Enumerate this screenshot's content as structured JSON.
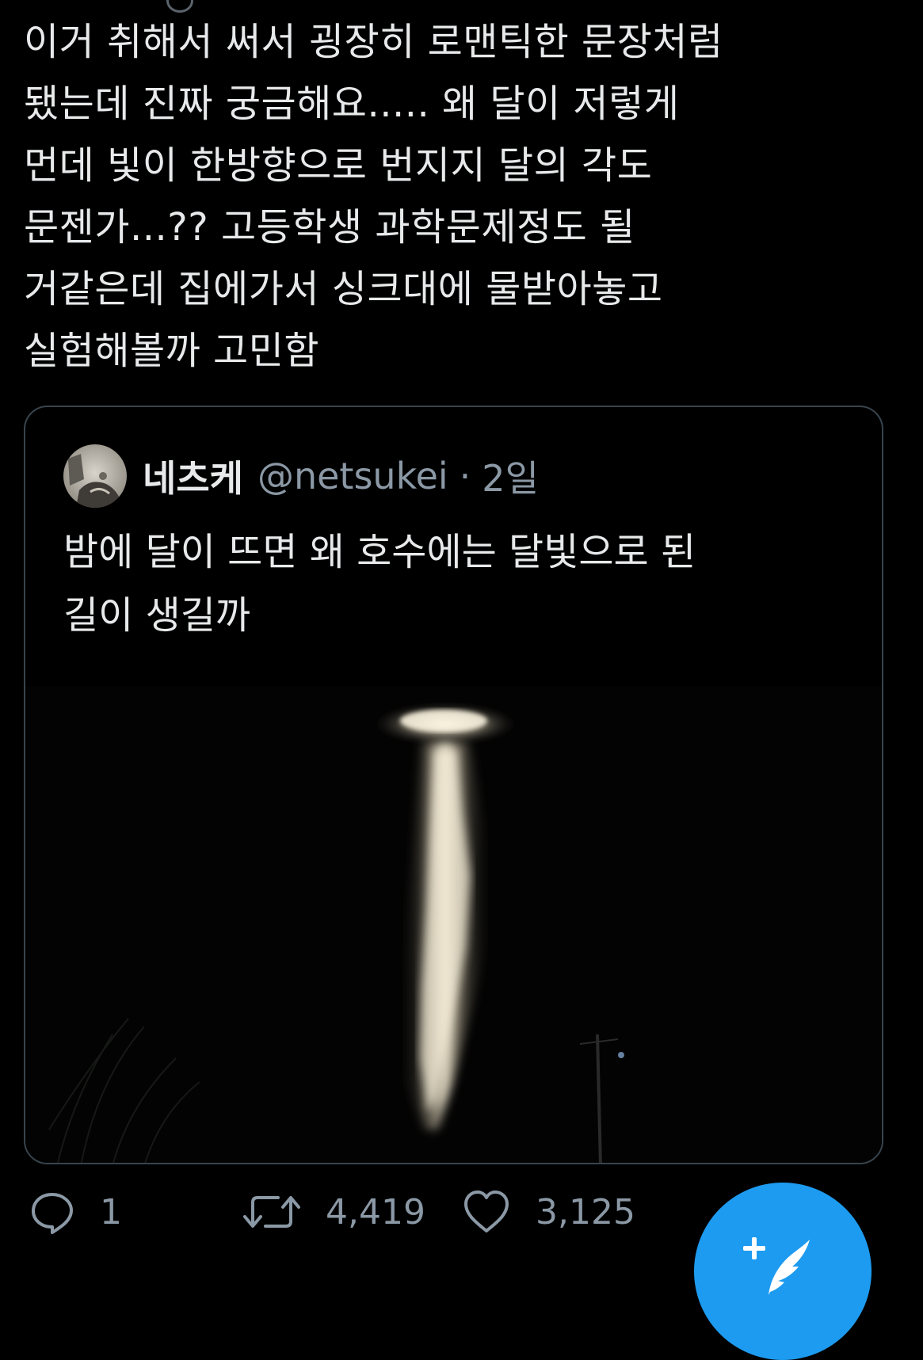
{
  "tweet": {
    "lines": [
      "이거 취해서 써서 굉장히 로맨틱한 문장처럼",
      "됐는데 진짜 궁금해요..... 왜 달이 저렇게",
      "먼데 빛이 한방향으로 번지지 달의 각도",
      "문젠가...?? 고등학생 과학문제정도 될",
      "거같은데 집에가서 싱크대에 물받아놓고",
      "실험해볼까 고민함"
    ]
  },
  "quote": {
    "author_name": "네츠케",
    "author_handle": "@netsukei",
    "separator": "·",
    "timestamp": "2일",
    "lines": [
      "밤에 달이 뜨면 왜 호수에는 달빛으로 된",
      "길이 생길까"
    ],
    "media": "moonlight reflected on lake at night"
  },
  "actions": {
    "reply_count": "1",
    "retweet_count": "4,419",
    "like_count": "3,125"
  },
  "icons": {
    "reply": "reply-icon",
    "retweet": "retweet-icon",
    "like": "heart-icon",
    "compose": "compose-tweet-icon"
  },
  "colors": {
    "background": "#000000",
    "text": "#e7e9ea",
    "muted": "#8b98a5",
    "border": "#38444d",
    "accent": "#1d9bf0"
  }
}
